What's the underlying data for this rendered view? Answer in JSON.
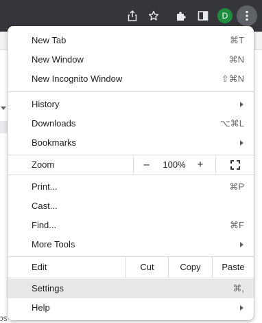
{
  "toolbar": {
    "share_icon": "share-icon",
    "bookmark_icon": "star-icon",
    "extensions_icon": "puzzle-icon",
    "side_panel_icon": "side-panel-icon",
    "profile_initial": "D",
    "profile_color": "#1e8e3e",
    "menu_icon": "three-dots-vertical-icon"
  },
  "menu": {
    "new_tab": {
      "label": "New Tab",
      "shortcut": "⌘T"
    },
    "new_window": {
      "label": "New Window",
      "shortcut": "⌘N"
    },
    "new_incognito": {
      "label": "New Incognito Window",
      "shortcut": "⇧⌘N"
    },
    "history": {
      "label": "History"
    },
    "downloads": {
      "label": "Downloads",
      "shortcut": "⌥⌘L"
    },
    "bookmarks": {
      "label": "Bookmarks"
    },
    "zoom": {
      "label": "Zoom",
      "minus": "–",
      "value": "100%",
      "plus": "+",
      "fullscreen_icon": "fullscreen-icon"
    },
    "print": {
      "label": "Print...",
      "shortcut": "⌘P"
    },
    "cast": {
      "label": "Cast..."
    },
    "find": {
      "label": "Find...",
      "shortcut": "⌘F"
    },
    "more_tools": {
      "label": "More Tools"
    },
    "edit": {
      "label": "Edit",
      "cut": "Cut",
      "copy": "Copy",
      "paste": "Paste"
    },
    "settings": {
      "label": "Settings",
      "shortcut": "⌘,",
      "highlighted": true
    },
    "help": {
      "label": "Help"
    }
  },
  "colors": {
    "toolbar_bg": "#35363a",
    "highlight": "#e8e8e9",
    "separator": "#dadce0",
    "text": "#202124",
    "shortcut_text": "#5f6368"
  }
}
